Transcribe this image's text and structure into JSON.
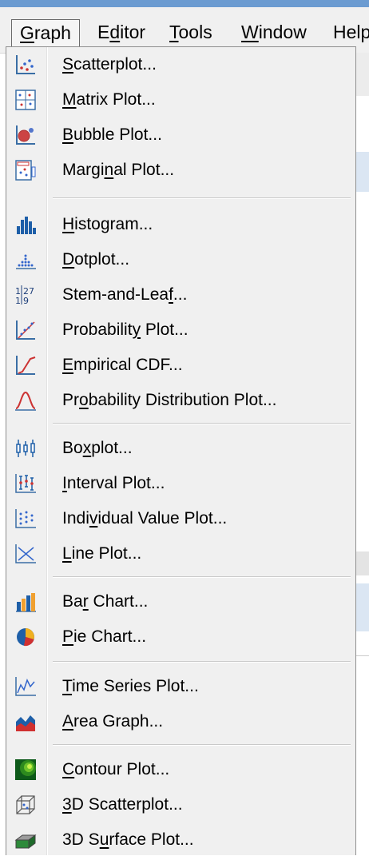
{
  "menubar": {
    "items": [
      {
        "pre": "",
        "u": "G",
        "post": "raph"
      },
      {
        "pre": "E",
        "u": "d",
        "post": "itor"
      },
      {
        "pre": "",
        "u": "T",
        "post": "ools"
      },
      {
        "pre": "",
        "u": "W",
        "post": "indow"
      },
      {
        "pre": "",
        "u": "",
        "post": "Help"
      }
    ]
  },
  "menu": {
    "items": [
      {
        "pre": "",
        "u": "S",
        "post": "catterplot...",
        "icon": "scatterplot-icon"
      },
      {
        "pre": "",
        "u": "M",
        "post": "atrix Plot...",
        "icon": "matrix-plot-icon"
      },
      {
        "pre": "",
        "u": "B",
        "post": "ubble Plot...",
        "icon": "bubble-plot-icon"
      },
      {
        "pre": "Margi",
        "u": "n",
        "post": "al Plot...",
        "icon": "marginal-plot-icon"
      },
      {
        "pre": "",
        "u": "H",
        "post": "istogram...",
        "icon": "histogram-icon"
      },
      {
        "pre": "",
        "u": "D",
        "post": "otplot...",
        "icon": "dotplot-icon"
      },
      {
        "pre": "Stem-and-Lea",
        "u": "f",
        "post": "...",
        "icon": "stem-and-leaf-icon"
      },
      {
        "pre": "Probabilit",
        "u": "y",
        "post": " Plot...",
        "icon": "probability-plot-icon"
      },
      {
        "pre": "",
        "u": "E",
        "post": "mpirical CDF...",
        "icon": "empirical-cdf-icon"
      },
      {
        "pre": "Pr",
        "u": "o",
        "post": "bability Distribution Plot...",
        "icon": "probability-distribution-icon"
      },
      {
        "pre": "Bo",
        "u": "x",
        "post": "plot...",
        "icon": "boxplot-icon"
      },
      {
        "pre": "",
        "u": "I",
        "post": "nterval Plot...",
        "icon": "interval-plot-icon"
      },
      {
        "pre": "Indi",
        "u": "v",
        "post": "idual Value Plot...",
        "icon": "individual-value-plot-icon"
      },
      {
        "pre": "",
        "u": "L",
        "post": "ine Plot...",
        "icon": "line-plot-icon"
      },
      {
        "pre": "Ba",
        "u": "r",
        "post": " Chart...",
        "icon": "bar-chart-icon"
      },
      {
        "pre": "",
        "u": "P",
        "post": "ie Chart...",
        "icon": "pie-chart-icon"
      },
      {
        "pre": "",
        "u": "T",
        "post": "ime Series Plot...",
        "icon": "time-series-icon"
      },
      {
        "pre": "",
        "u": "A",
        "post": "rea Graph...",
        "icon": "area-graph-icon"
      },
      {
        "pre": "",
        "u": "C",
        "post": "ontour Plot...",
        "icon": "contour-plot-icon"
      },
      {
        "pre": "",
        "u": "3",
        "post": "D Scatterplot...",
        "icon": "3d-scatterplot-icon"
      },
      {
        "pre": "3D S",
        "u": "u",
        "post": "rface Plot...",
        "icon": "3d-surface-plot-icon"
      }
    ]
  },
  "colors": {
    "menu_bg": "#f0f0f0",
    "highlight_blue": "#6b9bd1"
  }
}
